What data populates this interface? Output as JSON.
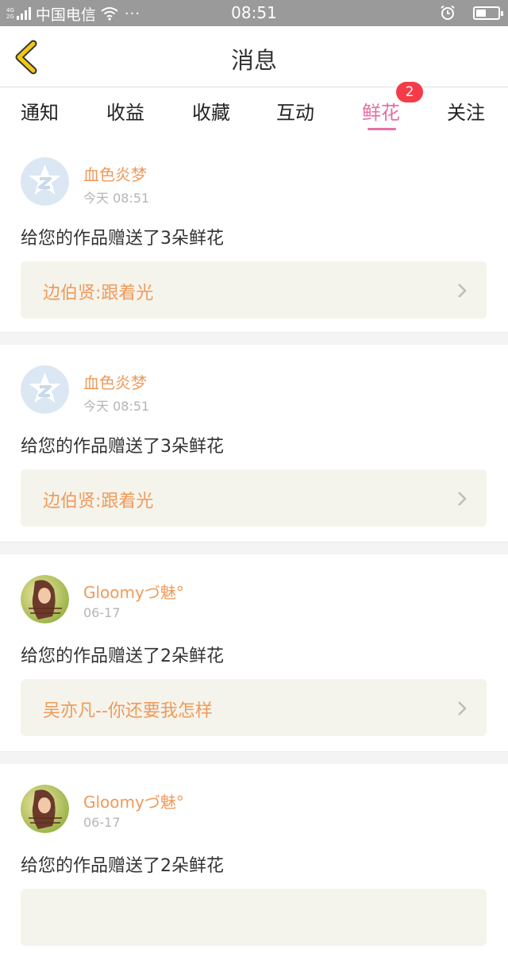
{
  "status_bar": {
    "network_top": "4G",
    "network_bottom": "2G",
    "carrier": "中国电信",
    "more": "···",
    "time": "08:51"
  },
  "header": {
    "title": "消息"
  },
  "tabs": [
    {
      "label": "通知",
      "active": false
    },
    {
      "label": "收益",
      "active": false
    },
    {
      "label": "收藏",
      "active": false
    },
    {
      "label": "互动",
      "active": false
    },
    {
      "label": "鲜花",
      "active": true,
      "badge": "2"
    },
    {
      "label": "关注",
      "active": false
    }
  ],
  "colors": {
    "accent": "#e86ea3",
    "username": "#ef9a5a",
    "badge": "#f43b47",
    "back_arrow": "#f2c812"
  },
  "messages": [
    {
      "username": "血色炎梦",
      "time": "今天 08:51",
      "text": "给您的作品赠送了3朵鲜花",
      "work": "边伯贤:跟着光",
      "avatar": "default-avatar-icon"
    },
    {
      "username": "血色炎梦",
      "time": "今天 08:51",
      "text": "给您的作品赠送了3朵鲜花",
      "work": "边伯贤:跟着光",
      "avatar": "default-avatar-icon"
    },
    {
      "username": "Gloomyづ魅°",
      "time": "06-17",
      "text": "给您的作品赠送了2朵鲜花",
      "work": "吴亦凡--你还要我怎样",
      "avatar": "user-photo"
    },
    {
      "username": "Gloomyづ魅°",
      "time": "06-17",
      "text": "给您的作品赠送了2朵鲜花",
      "work": "",
      "avatar": "user-photo"
    }
  ]
}
